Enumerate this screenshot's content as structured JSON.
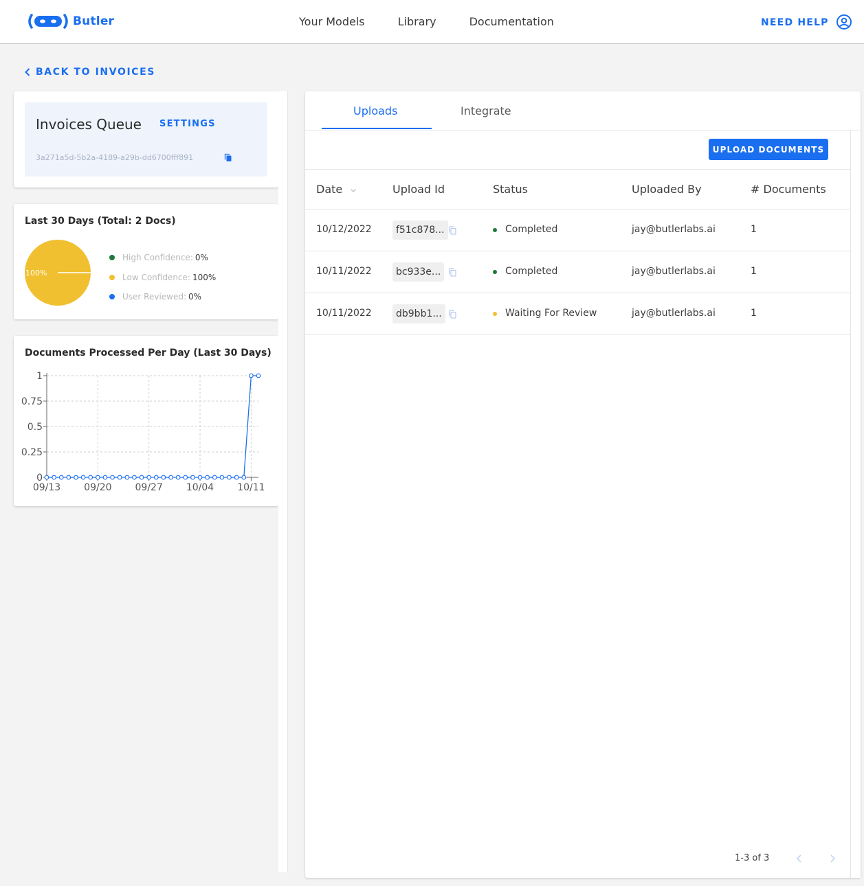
{
  "brand": {
    "name": "Butler",
    "accent": "#1a6ef0"
  },
  "nav": {
    "items": [
      "Your Models",
      "Library",
      "Documentation"
    ],
    "need_help": "NEED HELP"
  },
  "back_link": "BACK TO INVOICES",
  "queue": {
    "title": "Invoices Queue",
    "settings_label": "SETTINGS",
    "id": "3a271a5d-5b2a-4189-a29b-dd6700fff891"
  },
  "summary": {
    "heading": "Last 30 Days (Total: 2 Docs)",
    "pie_label": "100%",
    "legend": [
      {
        "label": "High Confidence:",
        "value": "0%",
        "color": "#1f7a3a"
      },
      {
        "label": "Low Confidence:",
        "value": "100%",
        "color": "#f0c030"
      },
      {
        "label": "User Reviewed:",
        "value": "0%",
        "color": "#1a6ef0"
      }
    ]
  },
  "chart_data": {
    "type": "line",
    "title": "Documents Processed Per Day (Last 30 Days)",
    "xlabel": "",
    "ylabel": "",
    "x_tick_labels": [
      "09/13",
      "09/20",
      "09/27",
      "10/04",
      "10/11"
    ],
    "y_tick_labels": [
      "0",
      "0.25",
      "0.5",
      "0.75",
      "1"
    ],
    "ylim": [
      0,
      1
    ],
    "grid": true,
    "series": [
      {
        "color": "#1a6ef0",
        "values": [
          0,
          0,
          0,
          0,
          0,
          0,
          0,
          0,
          0,
          0,
          0,
          0,
          0,
          0,
          0,
          0,
          0,
          0,
          0,
          0,
          0,
          0,
          0,
          0,
          0,
          0,
          0,
          0,
          1,
          1
        ]
      }
    ]
  },
  "tabs": [
    "Uploads",
    "Integrate"
  ],
  "upload_button": "UPLOAD DOCUMENTS",
  "table": {
    "headers": [
      "Date",
      "Upload Id",
      "Status",
      "Uploaded By",
      "# Documents"
    ],
    "rows": [
      {
        "date": "10/12/2022",
        "upload_id": "f51c878...",
        "status": "Completed",
        "status_color": "#1f7a3a",
        "by": "jay@butlerlabs.ai",
        "docs": "1"
      },
      {
        "date": "10/11/2022",
        "upload_id": "bc933e...",
        "status": "Completed",
        "status_color": "#1f7a3a",
        "by": "jay@butlerlabs.ai",
        "docs": "1"
      },
      {
        "date": "10/11/2022",
        "upload_id": "db9bb1...",
        "status": "Waiting For Review",
        "status_color": "#f0c030",
        "by": "jay@butlerlabs.ai",
        "docs": "1"
      }
    ]
  },
  "pagination": "1-3 of 3"
}
